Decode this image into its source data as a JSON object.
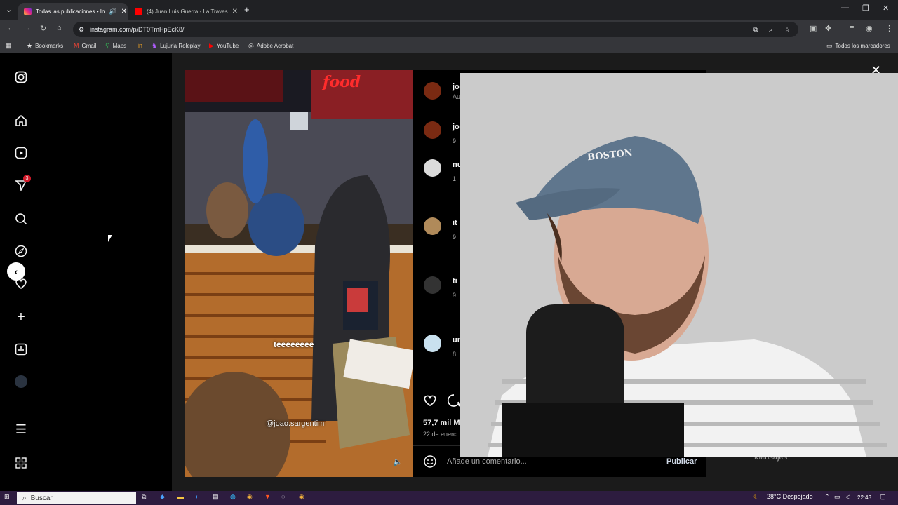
{
  "tabs": [
    {
      "title": "Todas las publicaciones • In",
      "state": "active"
    },
    {
      "title": "(4) Juan Luis Guerra - La Traves",
      "state": "inactive"
    }
  ],
  "toolbar": {
    "url": "instagram.com/p/DT0TmHpEcK8/"
  },
  "bookmarks": [
    {
      "label": "Bookmarks",
      "icon": "star-icon"
    },
    {
      "label": "Gmail",
      "icon": "gmail-icon"
    },
    {
      "label": "Maps",
      "icon": "maps-icon"
    },
    {
      "label": "",
      "icon": "in-icon"
    },
    {
      "label": "Lujuria Roleplay",
      "icon": "lujuria-icon"
    },
    {
      "label": "YouTube",
      "icon": "youtube-icon"
    },
    {
      "label": "Adobe Acrobat",
      "icon": "acrobat-icon"
    }
  ],
  "all_bookmarks": "Todos los marcadores",
  "sidebar": {
    "notification_count": "3"
  },
  "video": {
    "caption": "teeeeeeee",
    "handle": "@joao.sargentim",
    "sign_text": "food"
  },
  "comments": [
    {
      "name": "jo",
      "sub": "Au"
    },
    {
      "name": "jo",
      "sub": "9"
    },
    {
      "name": "nu",
      "sub": "1"
    },
    {
      "name": "it",
      "sub": "9"
    },
    {
      "name": "ti",
      "sub": "9"
    },
    {
      "name": "ur",
      "sub": "8"
    }
  ],
  "post": {
    "likes": "57,7 mil M",
    "date": "22 de enerc",
    "comment_placeholder": "Añade un comentario...",
    "publish_label": "Publicar"
  },
  "messages_label": "Mensajes",
  "webcam": {
    "cap_text": "BOSTON"
  },
  "taskbar": {
    "search_placeholder": "Buscar",
    "weather": "28°C  Despejado",
    "time": "22:43"
  }
}
